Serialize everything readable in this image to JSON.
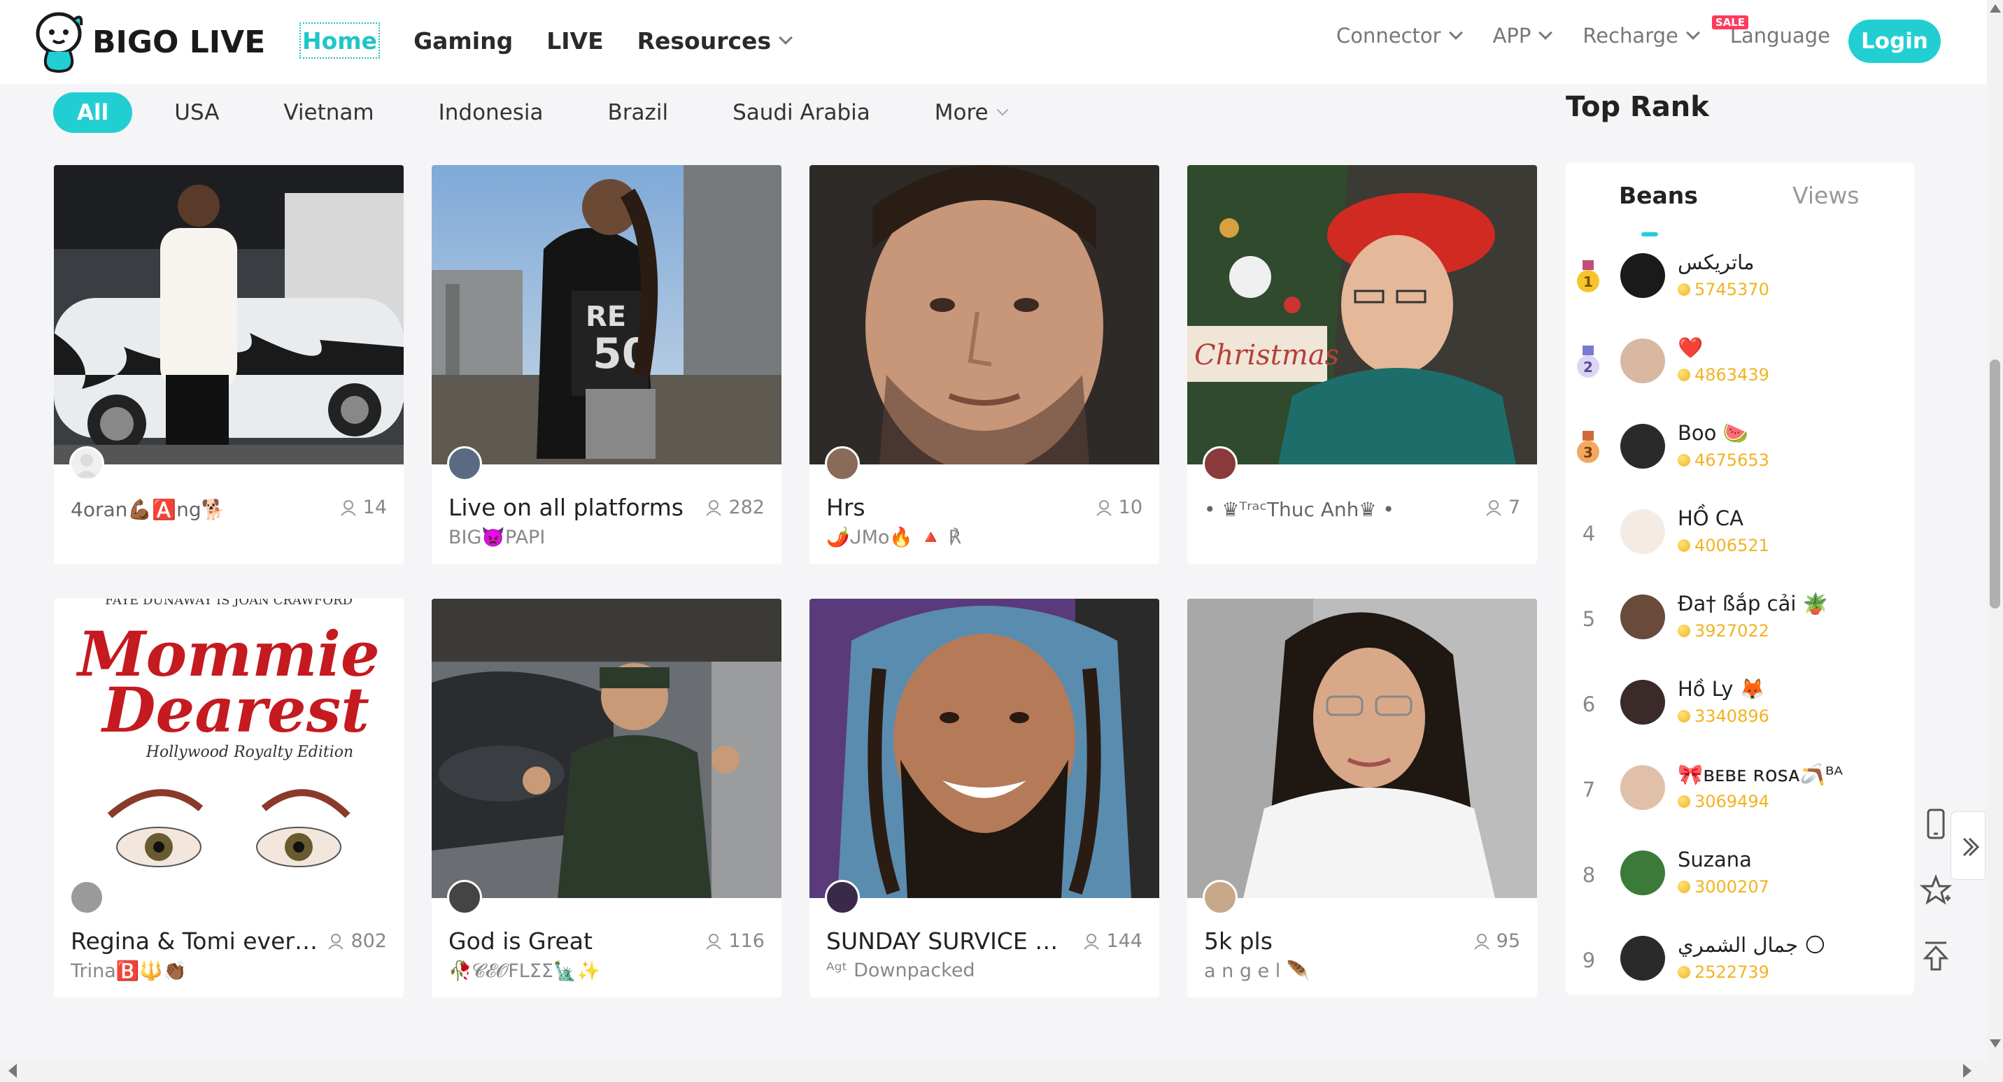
{
  "brand": {
    "name": "BIGO LIVE",
    "accent": "#21cfd3"
  },
  "nav": {
    "links": [
      {
        "label": "Home",
        "active": true
      },
      {
        "label": "Gaming"
      },
      {
        "label": "LIVE"
      },
      {
        "label": "Resources"
      }
    ],
    "right": {
      "connector": "Connector",
      "app": "APP",
      "recharge": "Recharge",
      "sale_badge": "SALE",
      "language": "Language",
      "login": "Login"
    }
  },
  "filters": [
    "All",
    "USA",
    "Vietnam",
    "Indonesia",
    "Brazil",
    "Saudi Arabia",
    "More"
  ],
  "cards": [
    {
      "title": "4oran💪🏾🅰️ng🐕",
      "title_style": "small",
      "viewers": "14",
      "subtitle": ""
    },
    {
      "title": "Live on all platforms",
      "viewers": "282",
      "subtitle": "BIG👿PAPI"
    },
    {
      "title": "Hrs",
      "viewers": "10",
      "subtitle": "🌶️ᒍMo🔥 🔺 ℟"
    },
    {
      "title": "• ♛ᵀʳᵃᶜThuc Anh♛ •",
      "title_style": "small",
      "viewers": "7",
      "subtitle": ""
    },
    {
      "title": "Regina & Tomi every…",
      "viewers": "802",
      "subtitle": "Trina🅱️🔱👏🏾"
    },
    {
      "title": "God is Great",
      "viewers": "116",
      "subtitle": "🥀𝓒𝓔𝓞FLΣΣ🗽✨"
    },
    {
      "title": "SUNDAY SURVICE 🙏🏼…",
      "viewers": "144",
      "subtitle": "ᴬᵍᵗ Downpacked"
    },
    {
      "title": "5k pls",
      "viewers": "95",
      "subtitle": "a n g e l 🪶"
    }
  ],
  "poster": {
    "top_line": "FAYE DUNAWAY IS JOAN CRAWFORD",
    "title_1": "Mommie",
    "title_2": "Dearest",
    "tagline": "Hollywood Royalty Edition"
  },
  "top_rank": {
    "title": "Top Rank",
    "tabs": [
      "Beans",
      "Views"
    ],
    "rows": [
      {
        "rank": "1",
        "name": "ماتريكس",
        "beans": "5745370"
      },
      {
        "rank": "2",
        "name": "❤️",
        "beans": "4863439"
      },
      {
        "rank": "3",
        "name": "Boo 🍉",
        "beans": "4675653"
      },
      {
        "rank": "4",
        "name": "HỒ CA",
        "beans": "4006521"
      },
      {
        "rank": "5",
        "name": "Đa† ßắp cải 🪴",
        "beans": "3927022"
      },
      {
        "rank": "6",
        "name": "Hồ Ly 🦊",
        "beans": "3340896"
      },
      {
        "rank": "7",
        "name": "🎀ʙᴇʙᴇ ʀᴏsᴀ🪃ᴮᴬ",
        "beans": "3069494"
      },
      {
        "rank": "8",
        "name": "Suzana",
        "beans": "3000207"
      },
      {
        "rank": "9",
        "name": "جمال الشمري 🌕",
        "beans": "2522739"
      }
    ]
  }
}
